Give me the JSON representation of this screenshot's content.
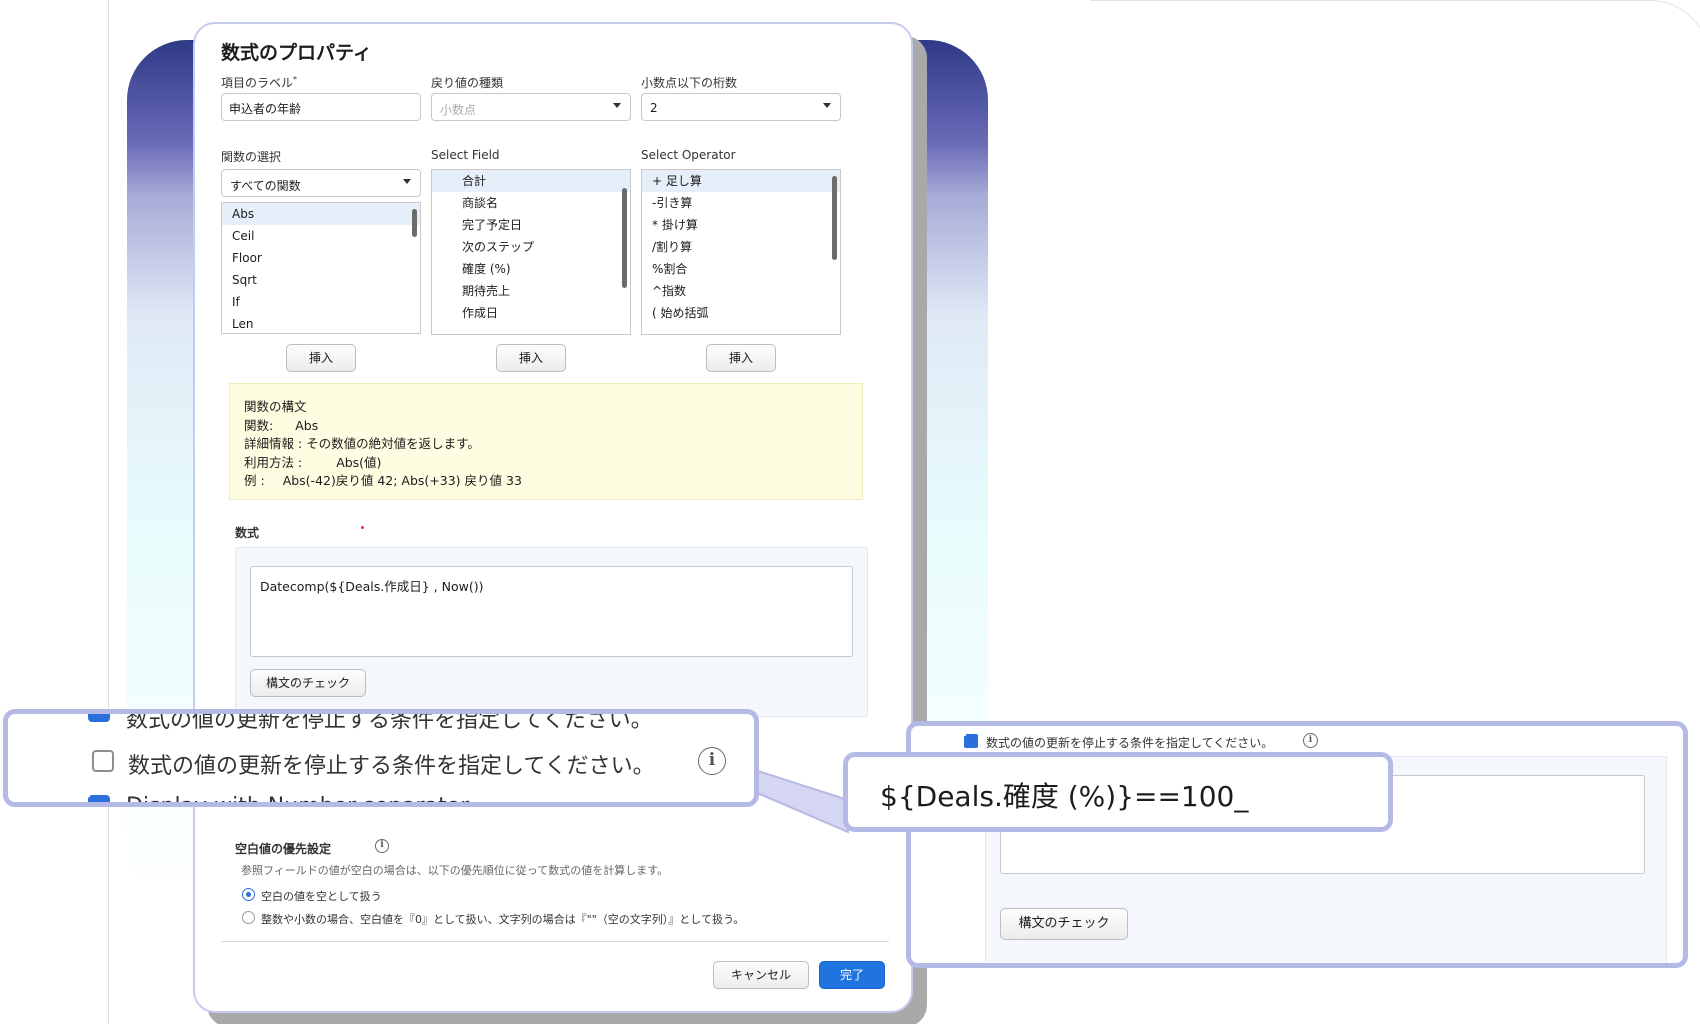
{
  "dialog": {
    "title": "数式のプロパティ",
    "field_label": {
      "label": "項目のラベル",
      "required_mark": "*",
      "value": "申込者の年齢"
    },
    "return_type": {
      "label": "戻り値の種類",
      "placeholder": "小数点"
    },
    "decimal_places": {
      "label": "小数点以下の桁数",
      "value": "2"
    },
    "function_select": {
      "label": "関数の選択",
      "value": "すべての関数",
      "items": [
        "Abs",
        "Ceil",
        "Floor",
        "Sqrt",
        "If",
        "Len"
      ]
    },
    "field_select": {
      "label": "Select Field",
      "items": [
        "合計",
        "商談名",
        "完了予定日",
        "次のステップ",
        "確度 (%)",
        "期待売上",
        "作成日"
      ]
    },
    "operator_select": {
      "label": "Select Operator",
      "items": [
        "+ 足し算",
        "-引き算",
        "* 掛け算",
        "/割り算",
        "%割合",
        "^指数",
        "( 始め括弧"
      ]
    },
    "insert_label": "挿入",
    "syntax": {
      "heading": "関数の構文",
      "function_label": "関数:",
      "function_value": "Abs",
      "detail_label": "詳細情報 :",
      "detail_value": "その数値の絶対値を返します。",
      "usage_label": "利用方法 :",
      "usage_value": "Abs(値)",
      "example_label": "例 :",
      "example_value": "Abs(-42)戻り値 42; Abs(+33) 戻り値 33"
    },
    "formula": {
      "label": "数式",
      "value": "Datecomp(${Deals.作成日} , Now())",
      "check_label": "構文のチェック"
    },
    "blank": {
      "label": "空白値の優先設定",
      "description": "参照フィールドの値が空白の場合は、以下の優先順位に従って数式の値を計算します。",
      "option1": "空白の値を空として扱う",
      "option2": "整数や小数の場合、空白値を『0』として扱い、文字列の場合は『\"\"（空の文字列）』として扱う。"
    },
    "cancel_label": "キャンセル",
    "done_label": "完了"
  },
  "zoom_left": {
    "partial_top": "数式の値の更新を停止する条件を指定してください。",
    "stop_label": "数式の値の更新を停止する条件を指定してください。",
    "partial_bottom": "Display with Number separator"
  },
  "zoom_right": {
    "stop_label": "数式の値の更新を停止する条件を指定してください。",
    "check_label": "構文のチェック"
  },
  "expression_callout": {
    "value": "${Deals.確度 (%)}==100_"
  },
  "colors": {
    "accent": "#1f74e0",
    "callout_border": "#b5b9e6",
    "syntax_bg": "#fffde1"
  }
}
